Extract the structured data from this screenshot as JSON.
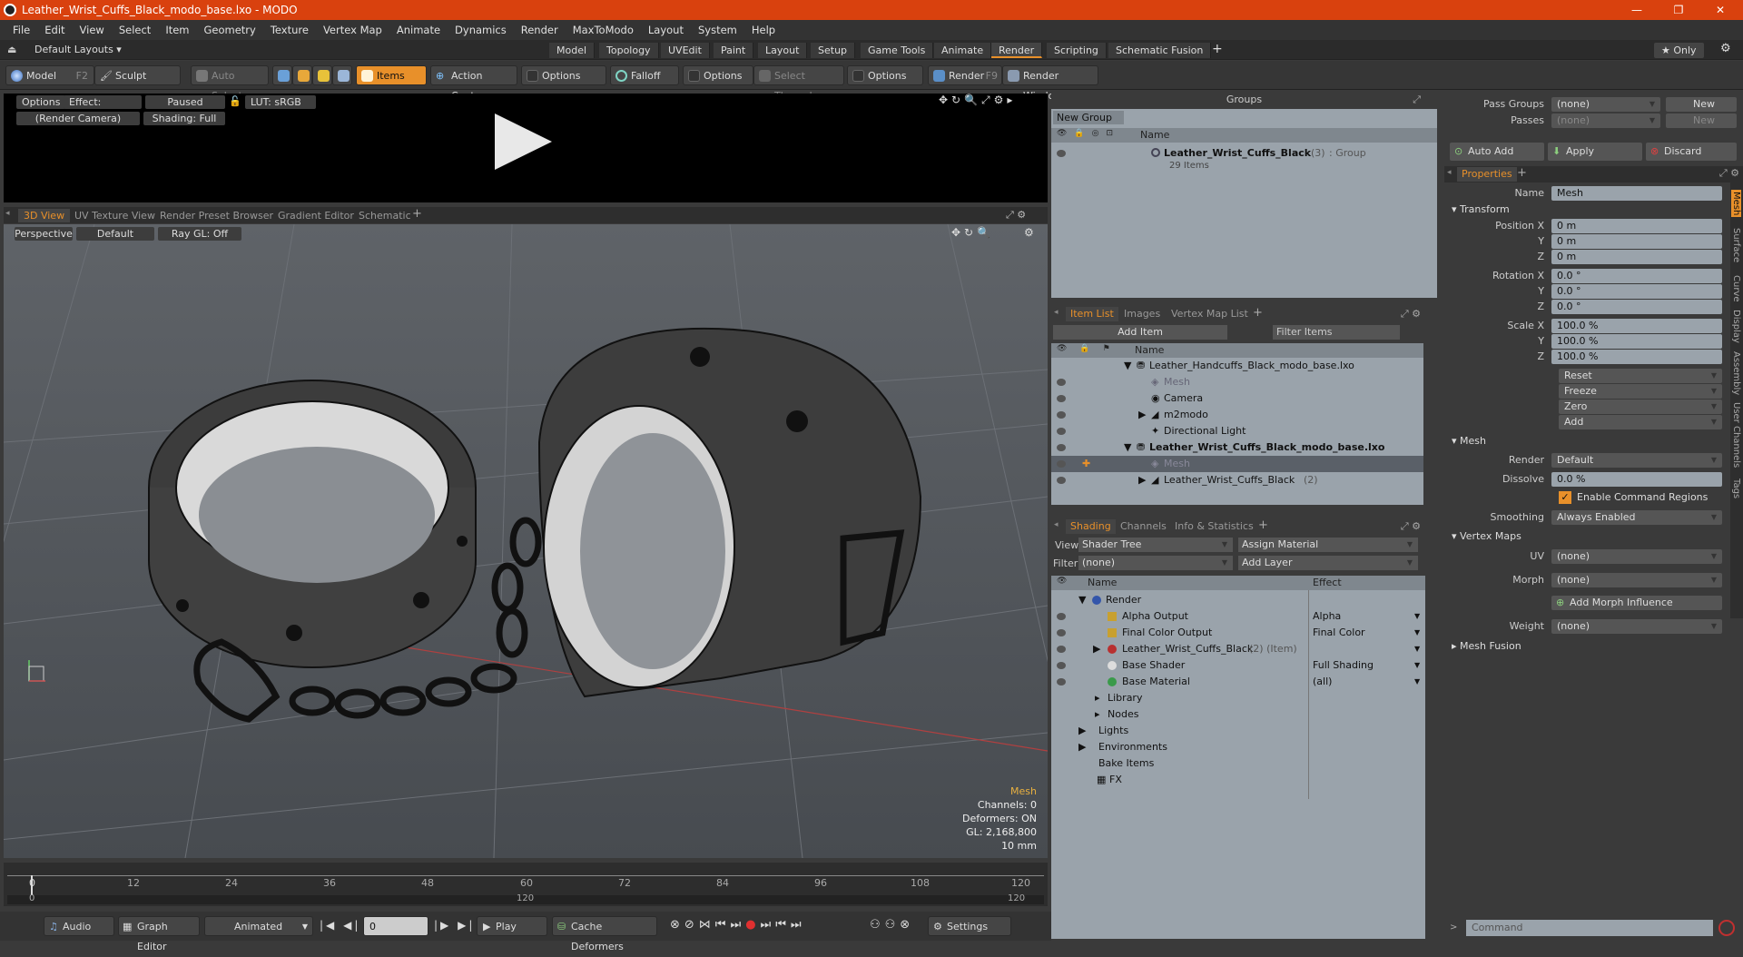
{
  "window": {
    "title": "Leather_Wrist_Cuffs_Black_modo_base.lxo - MODO"
  },
  "menu": [
    "File",
    "Edit",
    "View",
    "Select",
    "Item",
    "Geometry",
    "Texture",
    "Vertex Map",
    "Animate",
    "Dynamics",
    "Render",
    "MaxToModo",
    "Layout",
    "System",
    "Help"
  ],
  "layouts": {
    "selector": "Default Layouts ▾",
    "tabs": [
      "Model",
      "Topology",
      "UVEdit",
      "Paint",
      "Layout",
      "Setup",
      "Game Tools",
      "Animate",
      "Render",
      "Scripting",
      "Schematic Fusion"
    ],
    "active": "Render",
    "only": "★ Only"
  },
  "toolbar": {
    "model": "Model",
    "model_key": "F2",
    "sculpt": "Sculpt",
    "auto_select": "Auto Select",
    "items": "Items",
    "action_center": "Action Center",
    "options1": "Options",
    "falloff": "Falloff",
    "options2": "Options",
    "select_through": "Select Through",
    "options3": "Options",
    "render": "Render",
    "render_key": "F9",
    "render_window": "Render Window"
  },
  "preview": {
    "options": "Options",
    "effect": "Effect: (Shadi...",
    "paused": "Paused",
    "lut": "LUT: sRGB",
    "camera": "(Render Camera)",
    "shading": "Shading: Full"
  },
  "view_tabs": [
    "3D View",
    "UV Texture View",
    "Render Preset Browser",
    "Gradient Editor",
    "Schematic"
  ],
  "viewport": {
    "perspective": "Perspective",
    "default": "Default",
    "raygl": "Ray GL: Off",
    "info": [
      "Mesh",
      "Channels: 0",
      "Deformers: ON",
      "GL: 2,168,800",
      "10 mm"
    ]
  },
  "timeline": {
    "ticks": [
      "0",
      "12",
      "24",
      "36",
      "48",
      "60",
      "72",
      "84",
      "96",
      "108",
      "120"
    ],
    "bottom": [
      "0",
      "120",
      "120"
    ]
  },
  "bottombar": {
    "audio": "Audio",
    "graph_editor": "Graph Editor",
    "animated": "Animated",
    "frame": "0",
    "play": "Play",
    "cache": "Cache Deformers",
    "settings": "Settings"
  },
  "groups": {
    "title": "Groups",
    "new_group": "New Group",
    "col_name": "Name",
    "item_name": "Leather_Wrist_Cuffs_Black",
    "item_count": "(3)",
    "item_type": ": Group",
    "item_sub": "29 Items"
  },
  "itemlist": {
    "tabs": [
      "Item List",
      "Images",
      "Vertex Map List"
    ],
    "add_item": "Add Item",
    "filter": "Filter Items",
    "col_name": "Name",
    "rows": [
      "Leather_Handcuffs_Black_modo_base.lxo",
      "Mesh",
      "Camera",
      "m2modo",
      "Directional Light",
      "Leather_Wrist_Cuffs_Black_modo_base.lxo",
      "Mesh",
      "Leather_Wrist_Cuffs_Black"
    ],
    "count2": "(2)"
  },
  "shading": {
    "tabs": [
      "Shading",
      "Channels",
      "Info & Statistics"
    ],
    "view_label": "View",
    "view_value": "Shader Tree",
    "assign": "Assign Material",
    "filter_label": "Filter",
    "filter_value": "(none)",
    "add_layer": "Add Layer",
    "col_name": "Name",
    "col_effect": "Effect",
    "rows": [
      {
        "name": "Render",
        "effect": ""
      },
      {
        "name": "Alpha Output",
        "effect": "Alpha"
      },
      {
        "name": "Final Color Output",
        "effect": "Final Color"
      },
      {
        "name": "Leather_Wrist_Cuffs_Black",
        "effect": ""
      },
      {
        "name": "Base Shader",
        "effect": "Full Shading"
      },
      {
        "name": "Base Material",
        "effect": "(all)"
      },
      {
        "name": "Library",
        "effect": ""
      },
      {
        "name": "Nodes",
        "effect": ""
      },
      {
        "name": "Lights",
        "effect": ""
      },
      {
        "name": "Environments",
        "effect": ""
      },
      {
        "name": "Bake Items",
        "effect": ""
      },
      {
        "name": "FX",
        "effect": ""
      }
    ],
    "item_suffix": "(2) (Item)"
  },
  "props": {
    "pass_groups": "Pass Groups",
    "passes": "Passes",
    "none": "(none)",
    "new": "New",
    "auto_add": "Auto Add",
    "apply": "Apply",
    "discard": "Discard",
    "tab": "Properties",
    "name_label": "Name",
    "name_value": "Mesh",
    "transform": "Transform",
    "pos_label": "Position X",
    "rot_label": "Rotation X",
    "scale_label": "Scale X",
    "y": "Y",
    "z": "Z",
    "pos": [
      "0 m",
      "0 m",
      "0 m"
    ],
    "rot": [
      "0.0 °",
      "0.0 °",
      "0.0 °"
    ],
    "scale": [
      "100.0 %",
      "100.0 %",
      "100.0 %"
    ],
    "reset": "Reset",
    "freeze": "Freeze",
    "zero": "Zero",
    "add": "Add",
    "mesh": "Mesh",
    "render_label": "Render",
    "render_value": "Default",
    "dissolve_label": "Dissolve",
    "dissolve_value": "0.0 %",
    "cmd_regions": "Enable Command Regions",
    "smoothing_label": "Smoothing",
    "smoothing_value": "Always Enabled",
    "vertex_maps": "Vertex Maps",
    "uv_label": "UV",
    "uv_value": "(none)",
    "morph_label": "Morph",
    "morph_value": "(none)",
    "add_morph": "Add Morph Influence",
    "weight_label": "Weight",
    "weight_value": "(none)",
    "mesh_fusion": "Mesh Fusion",
    "side_tabs": [
      "Mesh",
      "Surface",
      "Curve",
      "Display",
      "Assembly",
      "User Channels",
      "Tags"
    ],
    "command": "Command"
  },
  "colors": {
    "accent": "#e8902a",
    "titlebar": "#d9410e",
    "panel_bg": "#9aa3ab"
  }
}
